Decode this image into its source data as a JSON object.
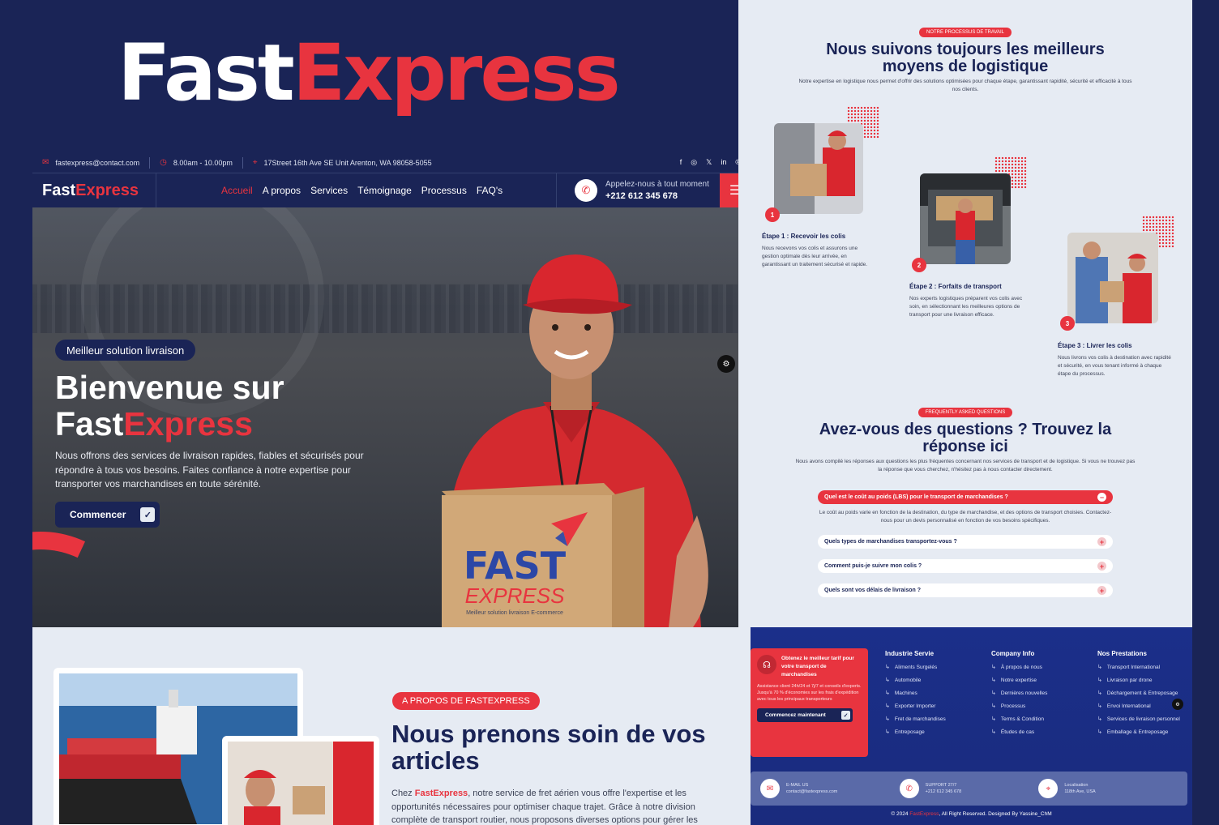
{
  "brand": {
    "name_part1": "Fast",
    "name_part2": "Express"
  },
  "topbar": {
    "email": "fastexpress@contact.com",
    "hours": "8.00am - 10.00pm",
    "address": "17Street 16th Ave SE Unit Arenton, WA 98058-5055",
    "socials": [
      "facebook-icon",
      "instagram-icon",
      "x-icon",
      "linkedin-icon",
      "pinterest-icon"
    ]
  },
  "nav": {
    "links": [
      "Accueil",
      "A propos",
      "Services",
      "Témoignage",
      "Processus",
      "FAQ's"
    ],
    "call_label": "Appelez-nous à tout moment",
    "call_number": "+212 612 345 678"
  },
  "hero": {
    "badge": "Meilleur solution livraison",
    "title_line1": "Bienvenue sur",
    "title_fast": "Fast",
    "title_express": "Express",
    "description": "Nous offrons des services de livraison rapides, fiables et sécurisés pour répondre à tous vos besoins. Faites confiance à notre expertise pour transporter vos marchandises en toute sérénité.",
    "button": "Commencer",
    "box_fast": "FAST",
    "box_express": "EXPRESS",
    "box_tagline": "Meilleur solution livraison E-commerce"
  },
  "about": {
    "badge": "A PROPOS DE FASTEXPRESS",
    "title": "Nous prenons soin de vos articles",
    "text_prefix": "Chez ",
    "text_brand": "FastExpress",
    "text_rest": ", notre service de fret aérien vous offre l'expertise et les opportunités nécessaires pour optimiser chaque trajet. Grâce à notre division complète de transport routier, nous proposons diverses options pour gérer les"
  },
  "process": {
    "badge": "NOTRE PROCESSUS DE TRAVAIL",
    "title": "Nous suivons toujours les meilleurs moyens de logistique",
    "description": "Notre expertise en logistique nous permet d'offrir des solutions optimisées pour chaque étape, garantissant rapidité, sécurité et efficacité à tous nos clients.",
    "steps": [
      {
        "num": "1",
        "title": "Étape 1 : Recevoir les colis",
        "text": "Nous recevons vos colis et assurons une gestion optimale dès leur arrivée, en garantissant un traitement sécurisé et rapide."
      },
      {
        "num": "2",
        "title": "Étape 2 : Forfaits de transport",
        "text": "Nos experts logistiques préparent vos colis avec soin, en sélectionnant les meilleures options de transport pour une livraison efficace."
      },
      {
        "num": "3",
        "title": "Étape 3 : Livrer les colis",
        "text": "Nous livrons vos colis à destination avec rapidité et sécurité, en vous tenant informé à chaque étape du processus."
      }
    ]
  },
  "faq": {
    "badge": "FREQUENTLY ASKED QUESTIONS",
    "title": "Avez-vous des questions ? Trouvez la réponse ici",
    "description": "Nous avons compilé les réponses aux questions les plus fréquentes concernant nos services de transport et de logistique. Si vous ne trouvez pas la réponse que vous cherchez, n'hésitez pas à nous contacter directement.",
    "items": [
      {
        "q": "Quel est le coût au poids (LBS) pour le transport de marchandises ?",
        "a": "Le coût au poids varie en fonction de la destination, du type de marchandise, et des options de transport choisies. Contactez-nous pour un devis personnalisé en fonction de vos besoins spécifiques."
      },
      {
        "q": "Quels types de marchandises transportez-vous ?"
      },
      {
        "q": "Comment puis-je suivre mon colis ?"
      },
      {
        "q": "Quels sont vos délais de livraison ?"
      }
    ]
  },
  "footer": {
    "cta_title": "Obtenez le meilleur tarif pour votre transport de marchandises",
    "cta_text": "Assistance client 24h/24 et 7j/7 et conseils d'experts. Jusqu'à 70 % d'économies sur les frais d'expédition avec tous les principaux transporteurs",
    "cta_button": "Commencez maintenant",
    "columns": [
      {
        "title": "Industrie Servie",
        "items": [
          "Aliments Surgelés",
          "Automobile",
          "Machines",
          "Exporter Importer",
          "Fret de marchandises",
          "Entreposage"
        ]
      },
      {
        "title": "Company Info",
        "items": [
          "À propos de nous",
          "Notre expertise",
          "Dernières nouvelles",
          "Processus",
          "Terms & Condition",
          "Études de cas"
        ]
      },
      {
        "title": "Nos Prestations",
        "items": [
          "Transport International",
          "Livraison par drone",
          "Déchargement & Entreposage",
          "Envoi International",
          "Services de livraison personnel",
          "Emballage & Entreposage"
        ]
      }
    ],
    "contact": [
      {
        "label": "E-MAIL US",
        "value": "contact@fastexpress.com"
      },
      {
        "label": "SUPPORT 27/7",
        "value": "+212 612 345 678"
      },
      {
        "label": "Localisation",
        "value": "118th Ave, USA"
      }
    ],
    "copyright_prefix": "© 2024 ",
    "copyright_brand": "FastExpress",
    "copyright_suffix": ", All Right Reserved. Designed By Yassine_ChM"
  },
  "colors": {
    "navy": "#1a2456",
    "red": "#e8343f",
    "light": "#e6ebf3"
  }
}
